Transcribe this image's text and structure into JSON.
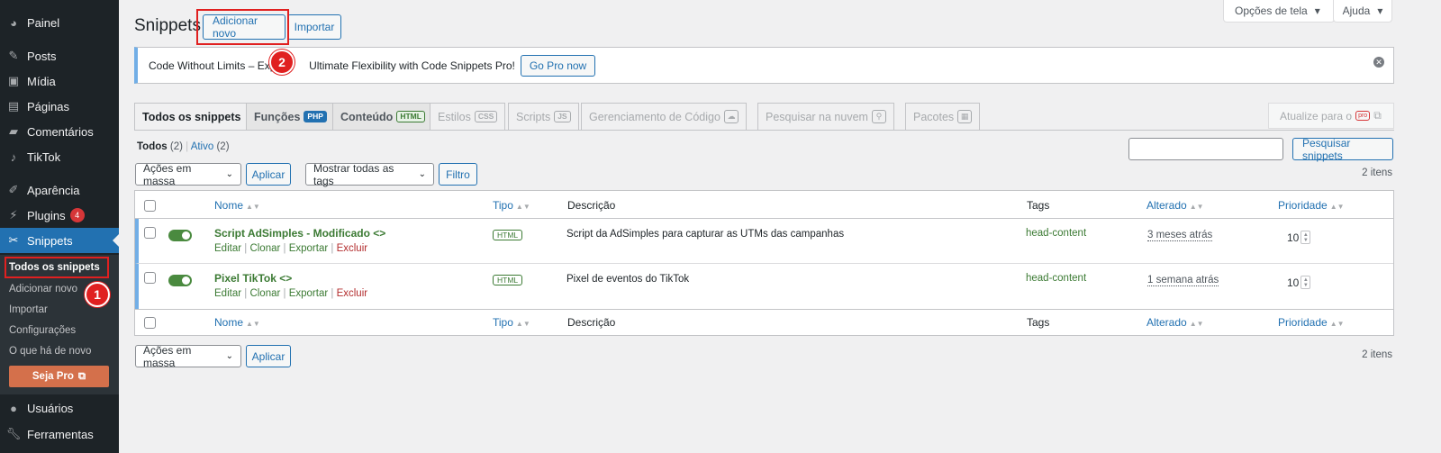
{
  "sidebar": {
    "items": [
      {
        "label": "Painel",
        "icon": "dashboard-icon"
      },
      {
        "label": "Posts",
        "icon": "pin-icon"
      },
      {
        "label": "Mídia",
        "icon": "media-icon"
      },
      {
        "label": "Páginas",
        "icon": "page-icon"
      },
      {
        "label": "Comentários",
        "icon": "comment-icon"
      },
      {
        "label": "TikTok",
        "icon": "tiktok-icon"
      },
      {
        "label": "Aparência",
        "icon": "brush-icon"
      },
      {
        "label": "Plugins",
        "icon": "plug-icon",
        "badge": "4"
      },
      {
        "label": "Snippets",
        "icon": "scissors-icon"
      },
      {
        "label": "Usuários",
        "icon": "user-icon"
      },
      {
        "label": "Ferramentas",
        "icon": "wrench-icon"
      }
    ],
    "submenu": [
      "Todos os snippets",
      "Adicionar novo",
      "Importar",
      "Configurações",
      "O que há de novo"
    ],
    "pro_button": "Seja Pro"
  },
  "header": {
    "title": "Snippets",
    "add_new": "Adicionar novo",
    "import": "Importar",
    "screen_options": "Opções de tela",
    "help": "Ajuda"
  },
  "notice": {
    "text_a": "Code Without Limits – Expe",
    "text_b": "Ultimate Flexibility with Code Snippets Pro!",
    "button": "Go Pro now"
  },
  "tabs": [
    {
      "label": "Todos os snippets",
      "badge": ""
    },
    {
      "label": "Funções",
      "badge": "PHP"
    },
    {
      "label": "Conteúdo",
      "badge": "HTML"
    },
    {
      "label": "Estilos",
      "badge": "CSS"
    },
    {
      "label": "Scripts",
      "badge": "JS"
    },
    {
      "label": "Gerenciamento de Código",
      "badge": ""
    },
    {
      "label": "Pesquisar na nuvem",
      "badge": ""
    },
    {
      "label": "Pacotes",
      "badge": ""
    }
  ],
  "upgrade_label": "Atualize para o",
  "filters": {
    "all_label": "Todos",
    "all_count": "(2)",
    "active_label": "Ativo",
    "active_count": "(2)",
    "bulk_actions": "Ações em massa",
    "apply": "Aplicar",
    "tags_select": "Mostrar todas as tags",
    "filter": "Filtro",
    "search_button": "Pesquisar snippets",
    "items_count": "2 itens"
  },
  "table": {
    "columns": {
      "name": "Nome",
      "type": "Tipo",
      "description": "Descrição",
      "tags": "Tags",
      "modified": "Alterado",
      "priority": "Prioridade"
    },
    "rows": [
      {
        "name": "Script AdSimples - Modificado",
        "type": "HTML",
        "description": "Script da AdSimples para capturar as UTMs das campanhas",
        "tags": "head-content",
        "modified": "3 meses atrás",
        "priority": "10",
        "active": true
      },
      {
        "name": "Pixel TikTok",
        "type": "HTML",
        "description": "Pixel de eventos do TikTok",
        "tags": "head-content",
        "modified": "1 semana atrás",
        "priority": "10",
        "active": true
      }
    ],
    "row_actions": {
      "edit": "Editar",
      "clone": "Clonar",
      "export": "Exportar",
      "delete": "Excluir"
    }
  },
  "annotations": {
    "step1": "1",
    "step2": "2"
  },
  "colors": {
    "sidebar": "#1d2327",
    "accent": "#2271b1",
    "snippet_green": "#3b7a33",
    "annotation_red": "#e02020"
  }
}
